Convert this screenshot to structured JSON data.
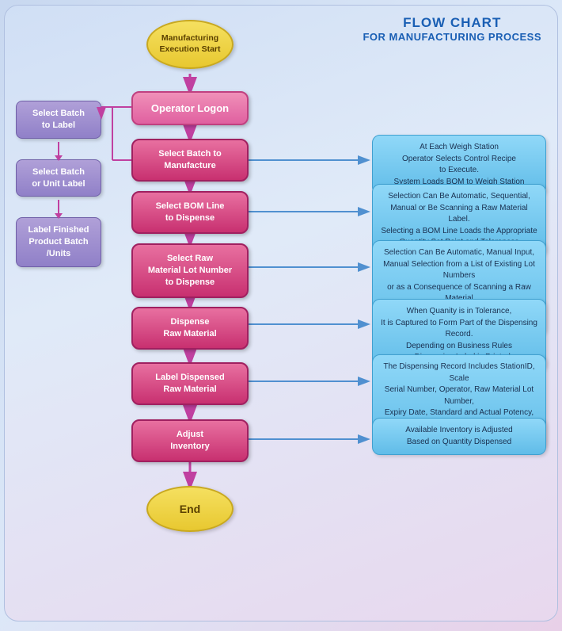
{
  "title": {
    "line1": "FLOW CHART",
    "line2": "FOR MANUFACTURING PROCESS"
  },
  "left_labels": [
    {
      "id": "select-batch-label",
      "text": "Select Batch\nto Label"
    },
    {
      "id": "select-batch-unit-label",
      "text": "Select Batch\nor Unit Label"
    },
    {
      "id": "label-finished-product",
      "text": "Label Finished\nProduct Batch\n/Units"
    }
  ],
  "center_flow": [
    {
      "id": "start-oval",
      "type": "oval",
      "text": "Manufacturing\nExecution Start"
    },
    {
      "id": "operator-logon",
      "type": "logon",
      "text": "Operator Logon"
    },
    {
      "id": "select-batch",
      "type": "rect",
      "text": "Select Batch to\nManufacture"
    },
    {
      "id": "select-bom",
      "type": "rect",
      "text": "Select BOM Line\nto Dispense"
    },
    {
      "id": "select-raw-material",
      "type": "rect",
      "text": "Select Raw\nMaterial Lot Number\nto Dispense"
    },
    {
      "id": "dispense-raw",
      "type": "rect",
      "text": "Dispense\nRaw Material"
    },
    {
      "id": "label-dispensed",
      "type": "rect",
      "text": "Label Dispensed\nRaw Material"
    },
    {
      "id": "adjust-inventory",
      "type": "rect",
      "text": "Adjust\nInventory"
    },
    {
      "id": "end-oval",
      "type": "oval",
      "text": "End"
    }
  ],
  "right_info": [
    {
      "id": "info-select-batch",
      "text": "At Each Weigh Station\nOperator Selects Control Recipe\nto Execute.\nSystem Loads BOM to Weigh Station"
    },
    {
      "id": "info-select-bom",
      "text": "Selection Can Be Automatic, Sequential,\nManual or Be Scanning a Raw Material Label.\nSelecting a BOM Line Loads the Appropriate\nQuantity Set Point and Tolerances"
    },
    {
      "id": "info-select-raw",
      "text": "Selection Can Be Automatic, Manual Input,\nManual Selection from a List of Existing Lot Numbers\nor as a Consequence of Scanning a Raw Material\nLabel, Depending on Configured Business Rules"
    },
    {
      "id": "info-dispense",
      "text": "When Quanity is in Tolerance,\nIt is Captured to Form Part of the Dispensing Record.\nDepending on Business Rules\na Dispensing Label is Printed"
    },
    {
      "id": "info-label",
      "text": "The Dispensing Record Includes StationID, Scale\nSerial Number, Operator, Raw Material Lot Number,\nExpiry Date, Standard and Actual Potency,\nTare Quantity, Nett Quantity, UOM, Date & Time"
    },
    {
      "id": "info-adjust",
      "text": "Available Inventory is Adjusted\nBased on Quantity Dispensed"
    }
  ]
}
